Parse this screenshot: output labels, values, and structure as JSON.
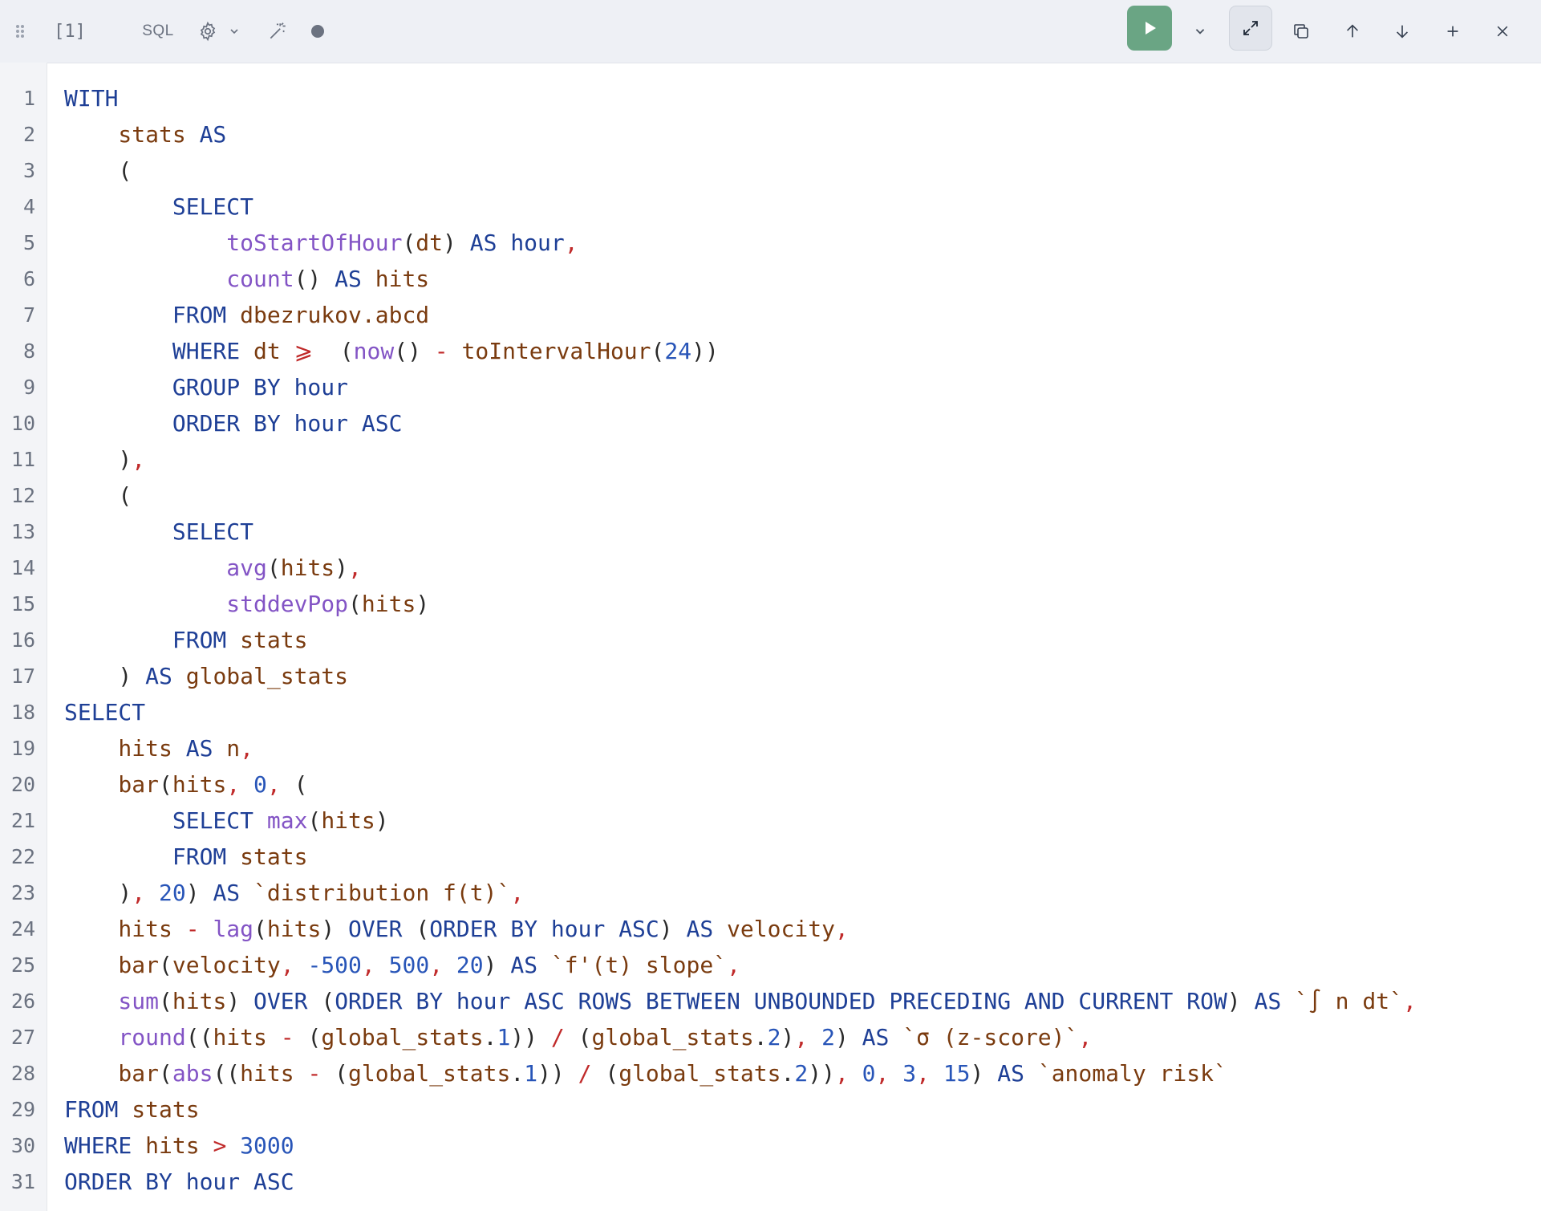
{
  "toolbar": {
    "cell_label": "[1]",
    "language": "SQL"
  },
  "colors": {
    "keyword": "#1e3f96",
    "function": "#8354c5",
    "identifier": "#7a3b0f",
    "number": "#2855b8",
    "operator": "#c02a2a",
    "run_button": "#6aa584"
  },
  "icons": [
    "drag-handle-icon",
    "gear-icon",
    "chevron-down-icon",
    "magic-wand-icon",
    "status-dot-icon",
    "play-icon",
    "expand-icon",
    "copy-icon",
    "arrow-up-icon",
    "arrow-down-icon",
    "plus-icon",
    "close-icon"
  ],
  "editor": {
    "lines": [
      [
        [
          "kw",
          "WITH"
        ]
      ],
      [
        [
          "id",
          "    stats "
        ],
        [
          "kw",
          "AS"
        ]
      ],
      [
        [
          "pn",
          "    ("
        ]
      ],
      [
        [
          "kw",
          "        SELECT"
        ]
      ],
      [
        [
          "fn",
          "            toStartOfHour"
        ],
        [
          "pn",
          "("
        ],
        [
          "id",
          "dt"
        ],
        [
          "pn",
          ") "
        ],
        [
          "kw",
          "AS"
        ],
        [
          "id",
          " "
        ],
        [
          "kw",
          "hour"
        ],
        [
          "op",
          ","
        ]
      ],
      [
        [
          "fn",
          "            count"
        ],
        [
          "pn",
          "() "
        ],
        [
          "kw",
          "AS"
        ],
        [
          "id",
          " hits"
        ]
      ],
      [
        [
          "kw",
          "        FROM"
        ],
        [
          "id",
          " dbezrukov.abcd"
        ]
      ],
      [
        [
          "kw",
          "        WHERE"
        ],
        [
          "id",
          " dt "
        ],
        [
          "op",
          "⩾"
        ],
        [
          "pn",
          "  ("
        ],
        [
          "fn",
          "now"
        ],
        [
          "pn",
          "() "
        ],
        [
          "op",
          "-"
        ],
        [
          "id",
          " toIntervalHour"
        ],
        [
          "pn",
          "("
        ],
        [
          "num",
          "24"
        ],
        [
          "pn",
          "))"
        ]
      ],
      [
        [
          "kw",
          "        GROUP BY"
        ],
        [
          "id",
          " "
        ],
        [
          "kw",
          "hour"
        ]
      ],
      [
        [
          "kw",
          "        ORDER BY"
        ],
        [
          "id",
          " "
        ],
        [
          "kw",
          "hour ASC"
        ]
      ],
      [
        [
          "pn",
          "    )"
        ],
        [
          "op",
          ","
        ]
      ],
      [
        [
          "pn",
          "    ("
        ]
      ],
      [
        [
          "kw",
          "        SELECT"
        ]
      ],
      [
        [
          "fn",
          "            avg"
        ],
        [
          "pn",
          "("
        ],
        [
          "id",
          "hits"
        ],
        [
          "pn",
          ")"
        ],
        [
          "op",
          ","
        ]
      ],
      [
        [
          "fn",
          "            stddevPop"
        ],
        [
          "pn",
          "("
        ],
        [
          "id",
          "hits"
        ],
        [
          "pn",
          ")"
        ]
      ],
      [
        [
          "kw",
          "        FROM"
        ],
        [
          "id",
          " stats"
        ]
      ],
      [
        [
          "pn",
          "    ) "
        ],
        [
          "kw",
          "AS"
        ],
        [
          "id",
          " global_stats"
        ]
      ],
      [
        [
          "kw",
          "SELECT"
        ]
      ],
      [
        [
          "id",
          "    hits "
        ],
        [
          "kw",
          "AS"
        ],
        [
          "id",
          " n"
        ],
        [
          "op",
          ","
        ]
      ],
      [
        [
          "id",
          "    bar"
        ],
        [
          "pn",
          "("
        ],
        [
          "id",
          "hits"
        ],
        [
          "op",
          ","
        ],
        [
          "id",
          " "
        ],
        [
          "num",
          "0"
        ],
        [
          "op",
          ","
        ],
        [
          "pn",
          " ("
        ]
      ],
      [
        [
          "kw",
          "        SELECT"
        ],
        [
          "id",
          " "
        ],
        [
          "fn",
          "max"
        ],
        [
          "pn",
          "("
        ],
        [
          "id",
          "hits"
        ],
        [
          "pn",
          ")"
        ]
      ],
      [
        [
          "kw",
          "        FROM"
        ],
        [
          "id",
          " stats"
        ]
      ],
      [
        [
          "pn",
          "    )"
        ],
        [
          "op",
          ","
        ],
        [
          "id",
          " "
        ],
        [
          "num",
          "20"
        ],
        [
          "pn",
          ") "
        ],
        [
          "kw",
          "AS"
        ],
        [
          "str",
          " `distribution f(t)`"
        ],
        [
          "op",
          ","
        ]
      ],
      [
        [
          "id",
          "    hits "
        ],
        [
          "op",
          "-"
        ],
        [
          "id",
          " "
        ],
        [
          "fn",
          "lag"
        ],
        [
          "pn",
          "("
        ],
        [
          "id",
          "hits"
        ],
        [
          "pn",
          ") "
        ],
        [
          "kw",
          "OVER"
        ],
        [
          "pn",
          " ("
        ],
        [
          "kw",
          "ORDER BY"
        ],
        [
          "id",
          " "
        ],
        [
          "kw",
          "hour ASC"
        ],
        [
          "pn",
          ") "
        ],
        [
          "kw",
          "AS"
        ],
        [
          "id",
          " velocity"
        ],
        [
          "op",
          ","
        ]
      ],
      [
        [
          "id",
          "    bar"
        ],
        [
          "pn",
          "("
        ],
        [
          "id",
          "velocity"
        ],
        [
          "op",
          ","
        ],
        [
          "id",
          " "
        ],
        [
          "num",
          "-500"
        ],
        [
          "op",
          ","
        ],
        [
          "id",
          " "
        ],
        [
          "num",
          "500"
        ],
        [
          "op",
          ","
        ],
        [
          "id",
          " "
        ],
        [
          "num",
          "20"
        ],
        [
          "pn",
          ") "
        ],
        [
          "kw",
          "AS"
        ],
        [
          "str",
          " `f'(t) slope`"
        ],
        [
          "op",
          ","
        ]
      ],
      [
        [
          "fn",
          "    sum"
        ],
        [
          "pn",
          "("
        ],
        [
          "id",
          "hits"
        ],
        [
          "pn",
          ") "
        ],
        [
          "kw",
          "OVER"
        ],
        [
          "pn",
          " ("
        ],
        [
          "kw",
          "ORDER BY"
        ],
        [
          "id",
          " "
        ],
        [
          "kw",
          "hour ASC ROWS BETWEEN UNBOUNDED PRECEDING AND CURRENT ROW"
        ],
        [
          "pn",
          ") "
        ],
        [
          "kw",
          "AS"
        ],
        [
          "str",
          " `∫ n dt`"
        ],
        [
          "op",
          ","
        ]
      ],
      [
        [
          "fn",
          "    round"
        ],
        [
          "pn",
          "(("
        ],
        [
          "id",
          "hits "
        ],
        [
          "op",
          "-"
        ],
        [
          "pn",
          " ("
        ],
        [
          "id",
          "global_stats"
        ],
        [
          "pn",
          "."
        ],
        [
          "num",
          "1"
        ],
        [
          "pn",
          ")) "
        ],
        [
          "op",
          "/"
        ],
        [
          "pn",
          " ("
        ],
        [
          "id",
          "global_stats"
        ],
        [
          "pn",
          "."
        ],
        [
          "num",
          "2"
        ],
        [
          "pn",
          ")"
        ],
        [
          "op",
          ","
        ],
        [
          "id",
          " "
        ],
        [
          "num",
          "2"
        ],
        [
          "pn",
          ") "
        ],
        [
          "kw",
          "AS"
        ],
        [
          "str",
          " `σ (z-score)`"
        ],
        [
          "op",
          ","
        ]
      ],
      [
        [
          "id",
          "    bar"
        ],
        [
          "pn",
          "("
        ],
        [
          "fn",
          "abs"
        ],
        [
          "pn",
          "(("
        ],
        [
          "id",
          "hits "
        ],
        [
          "op",
          "-"
        ],
        [
          "pn",
          " ("
        ],
        [
          "id",
          "global_stats"
        ],
        [
          "pn",
          "."
        ],
        [
          "num",
          "1"
        ],
        [
          "pn",
          ")) "
        ],
        [
          "op",
          "/"
        ],
        [
          "pn",
          " ("
        ],
        [
          "id",
          "global_stats"
        ],
        [
          "pn",
          "."
        ],
        [
          "num",
          "2"
        ],
        [
          "pn",
          "))"
        ],
        [
          "op",
          ","
        ],
        [
          "id",
          " "
        ],
        [
          "num",
          "0"
        ],
        [
          "op",
          ","
        ],
        [
          "id",
          " "
        ],
        [
          "num",
          "3"
        ],
        [
          "op",
          ","
        ],
        [
          "id",
          " "
        ],
        [
          "num",
          "15"
        ],
        [
          "pn",
          ") "
        ],
        [
          "kw",
          "AS"
        ],
        [
          "str",
          " `anomaly risk`"
        ]
      ],
      [
        [
          "kw",
          "FROM"
        ],
        [
          "id",
          " stats"
        ]
      ],
      [
        [
          "kw",
          "WHERE"
        ],
        [
          "id",
          " hits "
        ],
        [
          "op",
          ">"
        ],
        [
          "id",
          " "
        ],
        [
          "num",
          "3000"
        ]
      ],
      [
        [
          "kw",
          "ORDER BY"
        ],
        [
          "id",
          " "
        ],
        [
          "kw",
          "hour ASC"
        ]
      ]
    ]
  }
}
